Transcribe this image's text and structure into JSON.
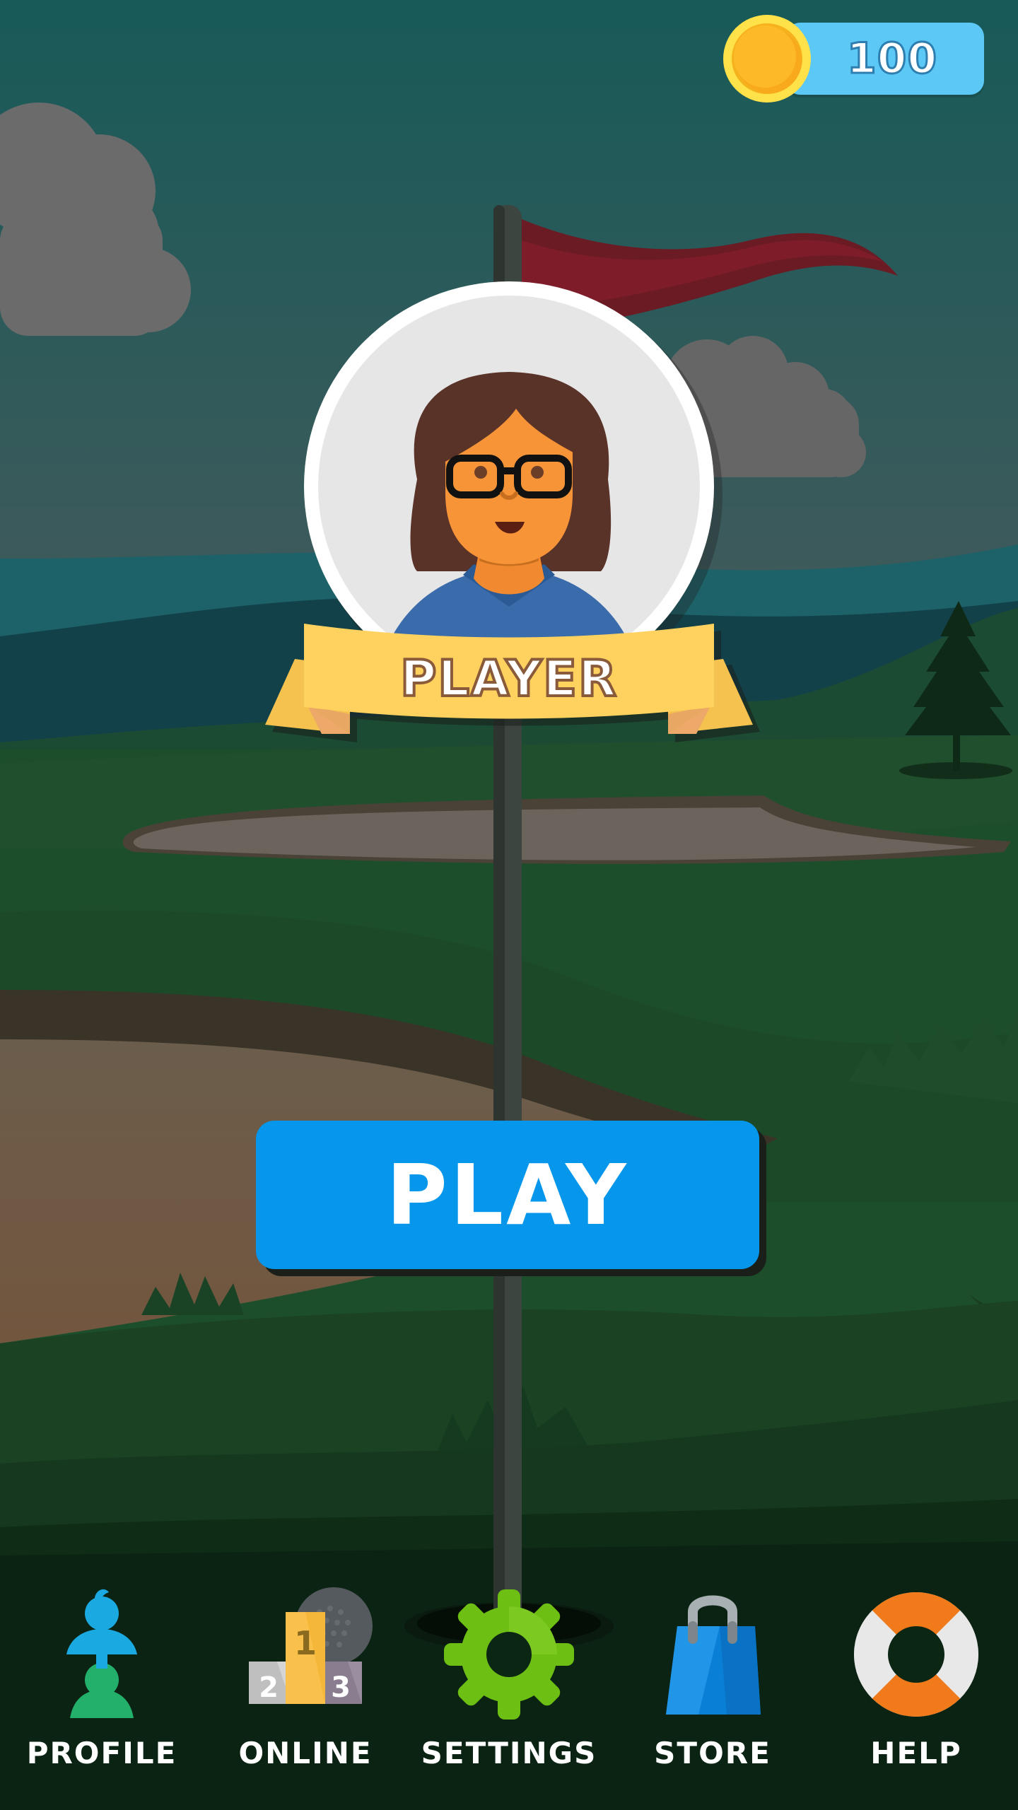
{
  "currency": {
    "coins": "100",
    "icon": "gold-coin-icon"
  },
  "player": {
    "name": "PLAYER",
    "avatar": "avatar-woman-glasses-icon"
  },
  "play_button": {
    "label": "PLAY"
  },
  "nav": {
    "items": [
      {
        "label": "PROFILE",
        "icon": "profile-icon"
      },
      {
        "label": "ONLINE",
        "icon": "podium-icon"
      },
      {
        "label": "SETTINGS",
        "icon": "gear-icon"
      },
      {
        "label": "STORE",
        "icon": "shopping-bag-icon"
      },
      {
        "label": "HELP",
        "icon": "lifebuoy-icon"
      }
    ]
  },
  "colors": {
    "sky_top": "#175a58",
    "sky_bottom": "#44575a",
    "grass": "#1e4f2c",
    "play_button": "#0697ec",
    "coin_pill": "#5cc8f5",
    "ribbon": "#ffd15e",
    "flag": "#6e1b24"
  }
}
